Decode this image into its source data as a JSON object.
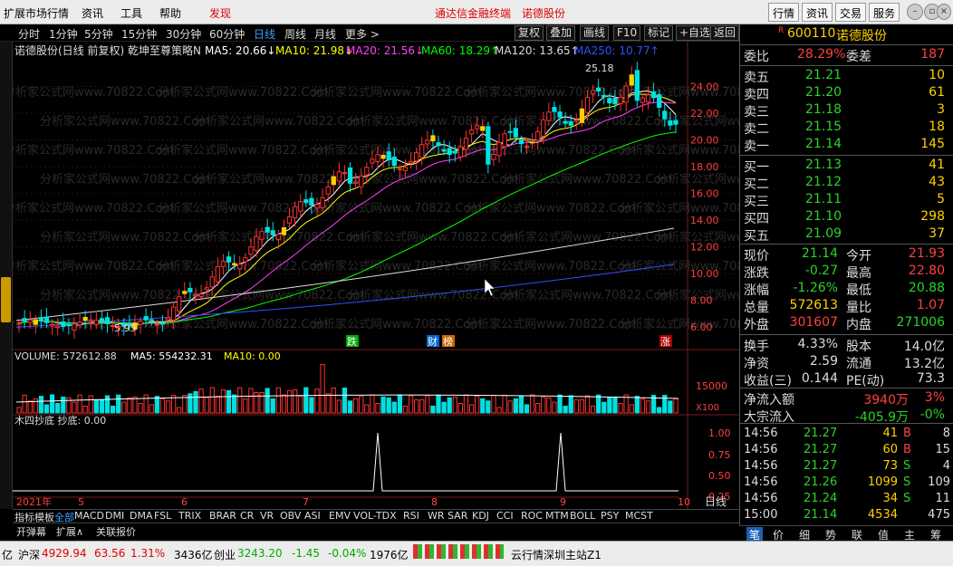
{
  "menu": {
    "items": [
      "扩展市场行情",
      "资讯",
      "工具",
      "帮助",
      "发现"
    ],
    "center_title": "通达信金融终端",
    "stock_title": "诺德股份",
    "right_buttons": [
      "行情",
      "资讯",
      "交易",
      "服务"
    ]
  },
  "periods": {
    "items": [
      "分时",
      "1分钟",
      "5分钟",
      "15分钟",
      "30分钟",
      "60分钟",
      "日线",
      "周线",
      "月线",
      "更多 >"
    ],
    "active": "日线"
  },
  "toolbar": {
    "buttons": [
      "复权",
      "叠加",
      "画线",
      "F10",
      "标记",
      "+自选",
      "返回"
    ]
  },
  "chart": {
    "header": "诺德股份(日线 前复权) 乾坤至尊策略N",
    "ma": [
      {
        "label": "MA5: 20.66↓",
        "color": "#ffffff"
      },
      {
        "label": "MA10: 21.98↓",
        "color": "#ffff00"
      },
      {
        "label": "MA20: 21.56↓",
        "color": "#ff40ff"
      },
      {
        "label": "MA60: 18.29↑",
        "color": "#00ff00"
      },
      {
        "label": "MA120: 13.65↑",
        "color": "#dddddd"
      },
      {
        "label": "MA250: 10.77↑",
        "color": "#3050ff"
      }
    ],
    "price_axis": [
      "24.00",
      "22.00",
      "20.00",
      "18.00",
      "16.00",
      "14.00",
      "12.00",
      "10.00",
      "8.00",
      "6.00"
    ],
    "high_label": "25.18",
    "low_label": "5.95",
    "markers": [
      "跌",
      "财",
      "榜",
      "涨"
    ],
    "volume_header": "VOLUME: 572612.88",
    "volume_ma5": "MA5: 554232.31",
    "volume_ma10": "MA10: 0.00",
    "volume_axis": [
      "15000",
      "X100"
    ],
    "indicator_header": "木四抄底 抄底: 0.00",
    "indicator_axis": [
      "1.00",
      "0.75",
      "0.50",
      "0.25"
    ],
    "date_labels": [
      "2021年",
      "5",
      "6",
      "7",
      "8",
      "9",
      "10"
    ],
    "period_label": "日线",
    "watermark": "分析家公式网www.70822.Com",
    "chart_data": {
      "type": "candlestick",
      "title": "诺德股份(日线 前复权)",
      "ylim": [
        5,
        26
      ],
      "price_high": 25.18,
      "price_low": 5.95,
      "last_close": 21.14,
      "volume_last": 572612.88,
      "volume_ma5": 554232.31
    }
  },
  "indicators": {
    "tabs": [
      "指标",
      "模板",
      "全部",
      "MACD",
      "DMI",
      "DMA",
      "FSL",
      "TRIX",
      "BRAR",
      "CR",
      "VR",
      "OBV",
      "ASI",
      "EMV",
      "VOL-TDX",
      "RSI",
      "WR",
      "SAR",
      "KDJ",
      "CCI",
      "ROC",
      "MTM",
      "BOLL",
      "PSY",
      "MCST"
    ],
    "active": "全部",
    "sub": [
      "开弹幕",
      "扩展∧",
      "关联报价"
    ]
  },
  "quote": {
    "code": "600110",
    "name": "诺德股份",
    "weibi_label": "委比",
    "weibi": "28.29%",
    "weicha_label": "委差",
    "weicha": "187",
    "sell": [
      {
        "label": "卖五",
        "price": "21.21",
        "vol": "10"
      },
      {
        "label": "卖四",
        "price": "21.20",
        "vol": "61"
      },
      {
        "label": "卖三",
        "price": "21.18",
        "vol": "3"
      },
      {
        "label": "卖二",
        "price": "21.15",
        "vol": "18"
      },
      {
        "label": "卖一",
        "price": "21.14",
        "vol": "145"
      }
    ],
    "buy": [
      {
        "label": "买一",
        "price": "21.13",
        "vol": "41"
      },
      {
        "label": "买二",
        "price": "21.12",
        "vol": "43"
      },
      {
        "label": "买三",
        "price": "21.11",
        "vol": "5"
      },
      {
        "label": "买四",
        "price": "21.10",
        "vol": "298"
      },
      {
        "label": "买五",
        "price": "21.09",
        "vol": "37"
      }
    ],
    "stats": [
      {
        "l1": "现价",
        "v1": "21.14",
        "c1": "dn",
        "l2": "今开",
        "v2": "21.93",
        "c2": "up"
      },
      {
        "l1": "涨跌",
        "v1": "-0.27",
        "c1": "dn",
        "l2": "最高",
        "v2": "22.80",
        "c2": "up"
      },
      {
        "l1": "涨幅",
        "v1": "-1.26%",
        "c1": "dn",
        "l2": "最低",
        "v2": "20.88",
        "c2": "dn"
      },
      {
        "l1": "总量",
        "v1": "572613",
        "c1": "yl",
        "l2": "量比",
        "v2": "1.07",
        "c2": "up"
      },
      {
        "l1": "外盘",
        "v1": "301607",
        "c1": "up",
        "l2": "内盘",
        "v2": "271006",
        "c2": "dn"
      }
    ],
    "fund": [
      {
        "l1": "换手",
        "v1": "4.33%",
        "l2": "股本",
        "v2": "14.0亿"
      },
      {
        "l1": "净资",
        "v1": "2.59",
        "l2": "流通",
        "v2": "13.2亿"
      },
      {
        "l1": "收益(三)",
        "v1": "0.144",
        "l2": "PE(动)",
        "v2": "73.3"
      }
    ],
    "flow": [
      {
        "label": "净流入额",
        "v1": "3940万",
        "v2": "3%",
        "c": "up"
      },
      {
        "label": "大宗流入",
        "v1": "-405.9万",
        "v2": "-0%",
        "c": "dn"
      }
    ],
    "ticks": [
      {
        "t": "14:56",
        "p": "21.27",
        "v": "41",
        "bs": "B",
        "n": "8"
      },
      {
        "t": "14:56",
        "p": "21.27",
        "v": "60",
        "bs": "B",
        "n": "15"
      },
      {
        "t": "14:56",
        "p": "21.27",
        "v": "73",
        "bs": "S",
        "n": "4"
      },
      {
        "t": "14:56",
        "p": "21.26",
        "v": "1099",
        "bs": "S",
        "n": "109"
      },
      {
        "t": "14:56",
        "p": "21.24",
        "v": "34",
        "bs": "S",
        "n": "11"
      },
      {
        "t": "15:00",
        "p": "21.14",
        "v": "4534",
        "bs": "",
        "n": "475"
      }
    ],
    "tabs": [
      "笔",
      "价",
      "细",
      "势",
      "联",
      "值",
      "主",
      "筹"
    ]
  },
  "status": {
    "prefix": "亿",
    "sh_label": "沪深",
    "sh_val": "4929.94",
    "sh_chg": "63.56",
    "sh_pct": "1.31%",
    "sh_amt": "3436亿",
    "cy_label": "创业",
    "cy_val": "3243.20",
    "cy_chg": "-1.45",
    "cy_pct": "-0.04%",
    "cy_amt": "1976亿",
    "server": "云行情深圳主站Z1"
  }
}
